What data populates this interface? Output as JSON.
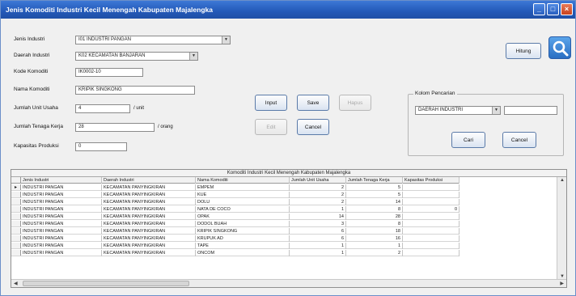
{
  "window": {
    "title": "Jenis Komoditi Industri Kecil Menengah Kabupaten Majalengka"
  },
  "form": {
    "jenis_industri": {
      "label": "Jenis Industri",
      "value": "I01    INDUSTRI PANGAN"
    },
    "daerah_industri": {
      "label": "Daerah Industri",
      "value": "K02    KECAMATAN BANJARAN"
    },
    "kode_komoditi": {
      "label": "Kode Komoditi",
      "value": "IK0002-10"
    },
    "nama_komoditi": {
      "label": "Nama Komoditi",
      "value": "KRIPIK SINGKONG"
    },
    "jumlah_unit_usaha": {
      "label": "Jumlah Unit Usaha",
      "value": "4",
      "suffix": "/ unit"
    },
    "jumlah_tenaga_kerja": {
      "label": "Jumlah Tenaga Kerja",
      "value": "28",
      "suffix": "/ orang"
    },
    "kapasitas_produksi": {
      "label": "Kapasitas Produksi",
      "value": "0"
    }
  },
  "buttons": {
    "input": "Input",
    "save": "Save",
    "hapus": "Hapus",
    "edit": "Edit",
    "cancel": "Cancel",
    "hitung": "Hitung"
  },
  "search": {
    "title": "Kolom Pencarian",
    "combo_value": "DAERAH INDUSTRI",
    "text_value": "",
    "cari": "Cari",
    "cancel": "Cancel"
  },
  "icons": {
    "search_icon": "magnifier"
  },
  "grid": {
    "caption": "Komoditi Industri Kecil Menengah Kabupaten Majalengka",
    "current_row_marker": "▸",
    "columns": [
      "Jenis Industri",
      "Daerah Industri",
      "Nama Komoditi",
      "Jumlah Unit Usaha",
      "Jumlah Tenaga Kerja",
      "Kapasitas Produksi"
    ],
    "rows": [
      [
        "INDUSTRI PANGAN",
        "KECAMATAN PANYINGKIRAN",
        "EMPEM",
        "2",
        "5",
        ""
      ],
      [
        "INDUSTRI PANGAN",
        "KECAMATAN PANYINGKIRAN",
        "KUE",
        "2",
        "5",
        ""
      ],
      [
        "INDUSTRI PANGAN",
        "KECAMATAN PANYINGKIRAN",
        "DOLU",
        "2",
        "14",
        ""
      ],
      [
        "INDUSTRI PANGAN",
        "KECAMATAN PANYINGKIRAN",
        "NATA DE COCO",
        "1",
        "8",
        "0"
      ],
      [
        "INDUSTRI PANGAN",
        "KECAMATAN PANYINGKIRAN",
        "OPAK",
        "14",
        "28",
        ""
      ],
      [
        "INDUSTRI PANGAN",
        "KECAMATAN PANYINGKIRAN",
        "DODOL BUAH",
        "3",
        "8",
        ""
      ],
      [
        "INDUSTRI PANGAN",
        "KECAMATAN PANYINGKIRAN",
        "KRIPIK SINGKONG",
        "6",
        "18",
        ""
      ],
      [
        "INDUSTRI PANGAN",
        "KECAMATAN PANYINGKIRAN",
        "KRUPUK AD",
        "6",
        "16",
        ""
      ],
      [
        "INDUSTRI PANGAN",
        "KECAMATAN PANYINGKIRAN",
        "TAPE",
        "1",
        "1",
        ""
      ],
      [
        "INDUSTRI PANGAN",
        "KECAMATAN PANYINGKIRAN",
        "ONCOM",
        "1",
        "2",
        ""
      ]
    ]
  }
}
